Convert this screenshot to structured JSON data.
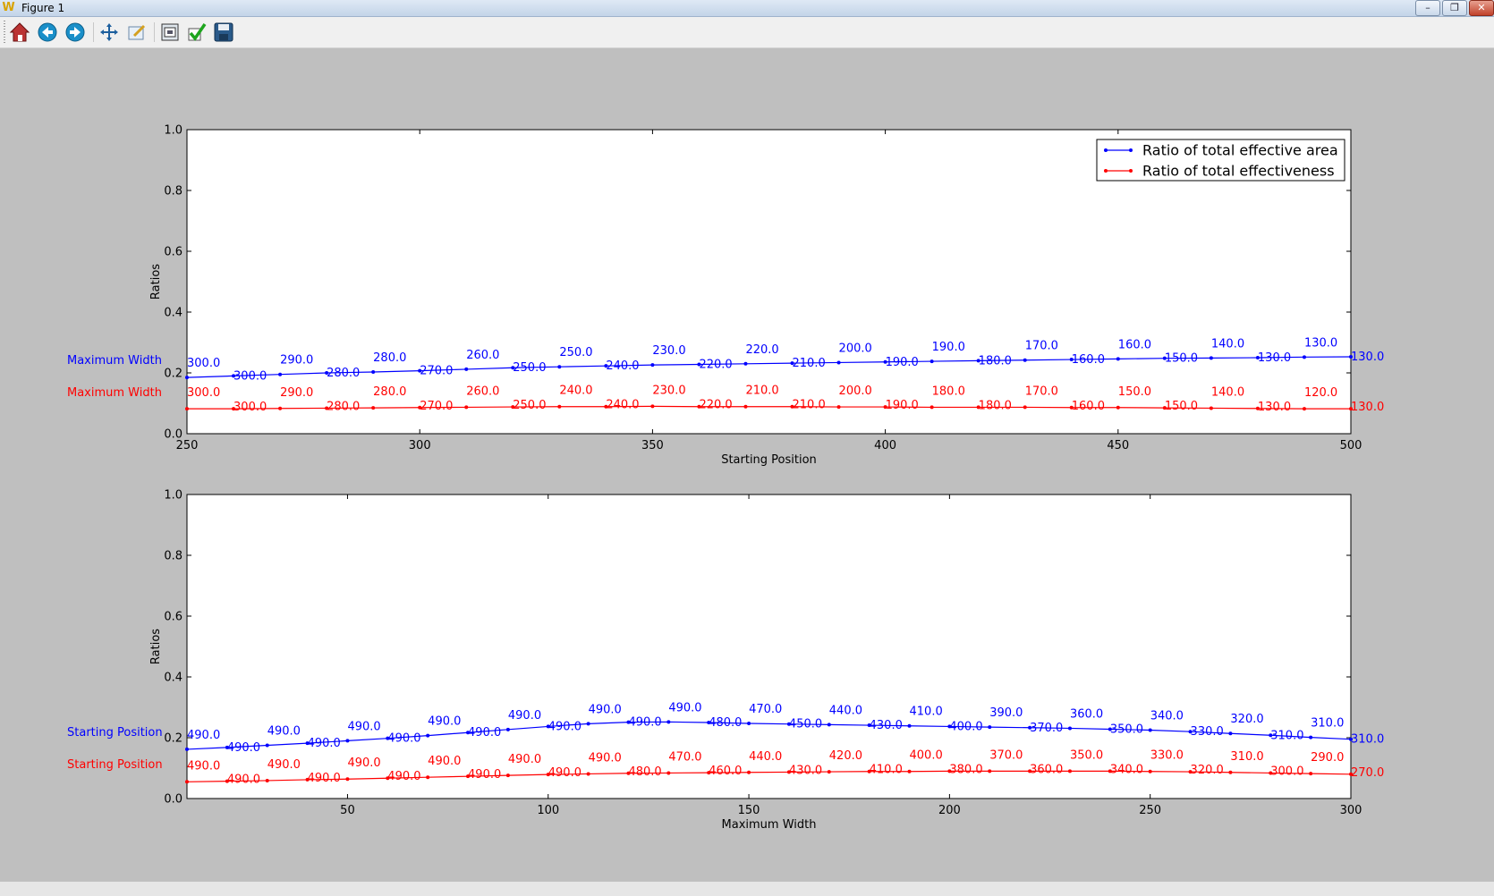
{
  "window": {
    "title": "Figure 1",
    "minimize": "–",
    "restore": "❐",
    "close": "✕"
  },
  "toolbar": {
    "buttons": [
      {
        "icon": "home-icon",
        "name": "home-button"
      },
      {
        "icon": "back-icon",
        "name": "back-button"
      },
      {
        "icon": "forward-icon",
        "name": "forward-button"
      },
      {
        "icon": "pan-icon",
        "name": "pan-button"
      },
      {
        "icon": "zoom-icon",
        "name": "zoom-button"
      },
      {
        "icon": "subplots-icon",
        "name": "configure-subplots-button"
      },
      {
        "icon": "check-icon",
        "name": "edit-axes-button"
      },
      {
        "icon": "save-icon",
        "name": "save-button"
      }
    ]
  },
  "colors": {
    "series1": "#0000ff",
    "series2": "#ff0000",
    "figure_bg": "#bfbfbf",
    "axes_bg": "#ffffff"
  },
  "chart_data": [
    {
      "type": "line",
      "xlabel": "Starting Position",
      "ylabel": "Ratios",
      "xlim": [
        250,
        500
      ],
      "ylim": [
        0.0,
        1.0
      ],
      "xticks": [
        "250",
        "300",
        "350",
        "400",
        "450",
        "500"
      ],
      "yticks": [
        "0.0",
        "0.2",
        "0.4",
        "0.6",
        "0.8",
        "1.0"
      ],
      "legend": {
        "placement": "top-right",
        "show": true
      },
      "side_labels": [
        "Maximum Width",
        "Maximum Width"
      ],
      "x": [
        250,
        260,
        270,
        280,
        290,
        300,
        310,
        320,
        330,
        340,
        350,
        360,
        370,
        380,
        390,
        400,
        410,
        420,
        430,
        440,
        450,
        460,
        470,
        480,
        490,
        500
      ],
      "series": [
        {
          "name": "Ratio of total effective area",
          "color": "#0000ff",
          "values": [
            0.185,
            0.19,
            0.195,
            0.2,
            0.203,
            0.207,
            0.212,
            0.217,
            0.22,
            0.223,
            0.226,
            0.228,
            0.23,
            0.232,
            0.234,
            0.236,
            0.238,
            0.24,
            0.242,
            0.244,
            0.246,
            0.248,
            0.249,
            0.25,
            0.252,
            0.253
          ],
          "labels": [
            "300.0",
            "300.0",
            "290.0",
            "280.0",
            "280.0",
            "270.0",
            "260.0",
            "250.0",
            "250.0",
            "240.0",
            "230.0",
            "220.0",
            "220.0",
            "210.0",
            "200.0",
            "190.0",
            "190.0",
            "180.0",
            "170.0",
            "160.0",
            "160.0",
            "150.0",
            "140.0",
            "130.0",
            "130.0",
            "130.0"
          ]
        },
        {
          "name": "Ratio of total effectiveness",
          "color": "#ff0000",
          "values": [
            0.082,
            0.082,
            0.083,
            0.084,
            0.085,
            0.086,
            0.087,
            0.088,
            0.089,
            0.089,
            0.09,
            0.089,
            0.089,
            0.089,
            0.088,
            0.088,
            0.087,
            0.087,
            0.087,
            0.086,
            0.086,
            0.085,
            0.084,
            0.083,
            0.082,
            0.082
          ],
          "labels": [
            "300.0",
            "300.0",
            "290.0",
            "280.0",
            "280.0",
            "270.0",
            "260.0",
            "250.0",
            "240.0",
            "240.0",
            "230.0",
            "220.0",
            "210.0",
            "210.0",
            "200.0",
            "190.0",
            "180.0",
            "180.0",
            "170.0",
            "160.0",
            "150.0",
            "150.0",
            "140.0",
            "130.0",
            "120.0",
            "130.0"
          ]
        }
      ]
    },
    {
      "type": "line",
      "xlabel": "Maximum Width",
      "ylabel": "Ratios",
      "xlim": [
        10,
        300
      ],
      "ylim": [
        0.0,
        1.0
      ],
      "xticks": [
        "50",
        "100",
        "150",
        "200",
        "250",
        "300"
      ],
      "yticks": [
        "0.0",
        "0.2",
        "0.4",
        "0.6",
        "0.8",
        "1.0"
      ],
      "legend": {
        "show": false
      },
      "side_labels": [
        "Starting Position",
        "Starting Position"
      ],
      "x": [
        10,
        20,
        30,
        40,
        50,
        60,
        70,
        80,
        90,
        100,
        110,
        120,
        130,
        140,
        150,
        160,
        170,
        180,
        190,
        200,
        210,
        220,
        230,
        240,
        250,
        260,
        270,
        280,
        290,
        300
      ],
      "series": [
        {
          "name": "Ratio of total effective area",
          "color": "#0000ff",
          "values": [
            0.162,
            0.168,
            0.175,
            0.182,
            0.19,
            0.198,
            0.207,
            0.217,
            0.227,
            0.237,
            0.246,
            0.251,
            0.252,
            0.25,
            0.247,
            0.245,
            0.243,
            0.241,
            0.239,
            0.237,
            0.235,
            0.233,
            0.231,
            0.228,
            0.225,
            0.22,
            0.214,
            0.208,
            0.201,
            0.195
          ],
          "labels": [
            "490.0",
            "490.0",
            "490.0",
            "490.0",
            "490.0",
            "490.0",
            "490.0",
            "490.0",
            "490.0",
            "490.0",
            "490.0",
            "490.0",
            "490.0",
            "480.0",
            "470.0",
            "450.0",
            "440.0",
            "430.0",
            "410.0",
            "400.0",
            "390.0",
            "370.0",
            "360.0",
            "350.0",
            "340.0",
            "330.0",
            "320.0",
            "310.0",
            "310.0",
            "310.0"
          ]
        },
        {
          "name": "Ratio of total effectiveness",
          "color": "#ff0000",
          "values": [
            0.055,
            0.057,
            0.059,
            0.062,
            0.064,
            0.067,
            0.07,
            0.073,
            0.076,
            0.079,
            0.081,
            0.083,
            0.084,
            0.085,
            0.086,
            0.087,
            0.088,
            0.089,
            0.089,
            0.09,
            0.09,
            0.09,
            0.09,
            0.09,
            0.089,
            0.088,
            0.086,
            0.084,
            0.082,
            0.08
          ],
          "labels": [
            "490.0",
            "490.0",
            "490.0",
            "490.0",
            "490.0",
            "490.0",
            "490.0",
            "490.0",
            "490.0",
            "490.0",
            "490.0",
            "480.0",
            "470.0",
            "460.0",
            "440.0",
            "430.0",
            "420.0",
            "410.0",
            "400.0",
            "380.0",
            "370.0",
            "360.0",
            "350.0",
            "340.0",
            "330.0",
            "320.0",
            "310.0",
            "300.0",
            "290.0",
            "270.0"
          ]
        }
      ]
    }
  ]
}
